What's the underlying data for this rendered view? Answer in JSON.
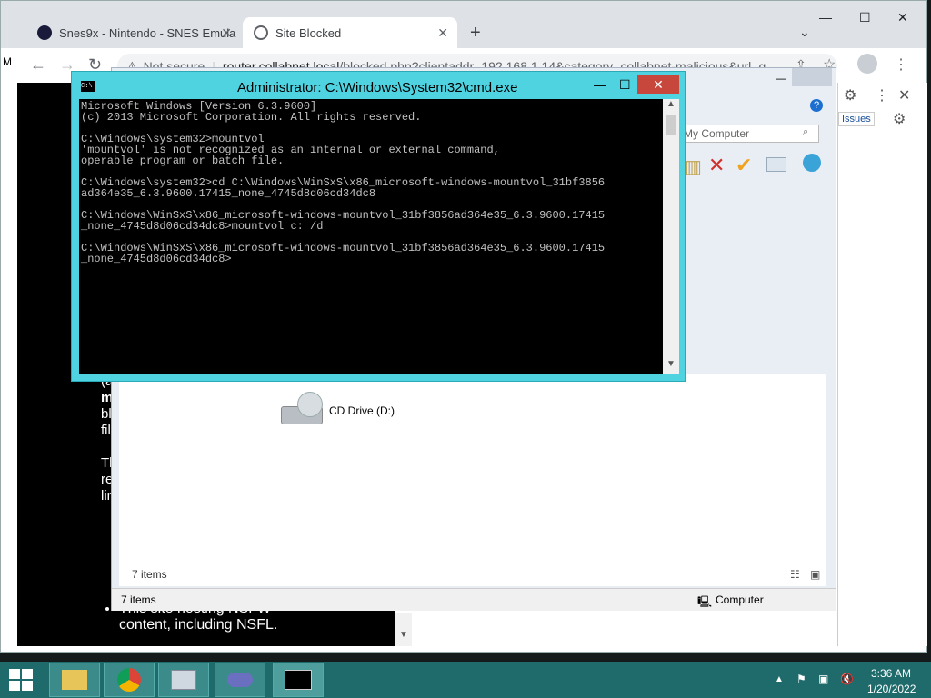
{
  "browser": {
    "tabs": [
      {
        "label": "Snes9x - Nintendo - SNES Emula"
      },
      {
        "label": "Site Blocked"
      }
    ],
    "new_tab": "+",
    "tab_dropdown": "⌄",
    "window_buttons": {
      "minimize": "—",
      "maximize": "☐",
      "close": "✕"
    },
    "nav": {
      "back": "←",
      "forward": "→",
      "reload": "↻"
    },
    "omnibox": {
      "security": "Not secure",
      "domain": "router.collabnet.local",
      "path": "/blocked.php?clientaddr=192.168.1.14&category=collabnet-malicious&url=g"
    },
    "left_edge_letter": "M"
  },
  "blocked_page": {
    "fragments": [
      "(a",
      "m",
      "bl",
      "fil",
      "Th",
      "re",
      "lin"
    ],
    "bullet": "This site hosting NSFW content, including NSFL."
  },
  "explorer": {
    "search_placeholder": "My Computer",
    "issues_label": "Issues",
    "drive_label": "CD Drive (D:)",
    "items_count_inner": "7 items",
    "status_items": "7 items",
    "status_location": "Computer"
  },
  "cmd": {
    "title": "Administrator: C:\\Windows\\System32\\cmd.exe",
    "icon_text": "C:\\",
    "lines": [
      "Microsoft Windows [Version 6.3.9600]",
      "(c) 2013 Microsoft Corporation. All rights reserved.",
      "",
      "C:\\Windows\\system32>mountvol",
      "'mountvol' is not recognized as an internal or external command,",
      "operable program or batch file.",
      "",
      "C:\\Windows\\system32>cd C:\\Windows\\WinSxS\\x86_microsoft-windows-mountvol_31bf3856",
      "ad364e35_6.3.9600.17415_none_4745d8d06cd34dc8",
      "",
      "C:\\Windows\\WinSxS\\x86_microsoft-windows-mountvol_31bf3856ad364e35_6.3.9600.17415",
      "_none_4745d8d06cd34dc8>mountvol c: /d",
      "",
      "C:\\Windows\\WinSxS\\x86_microsoft-windows-mountvol_31bf3856ad364e35_6.3.9600.17415",
      "_none_4745d8d06cd34dc8>"
    ]
  },
  "taskbar": {
    "time": "3:36 AM",
    "date": "1/20/2022"
  }
}
